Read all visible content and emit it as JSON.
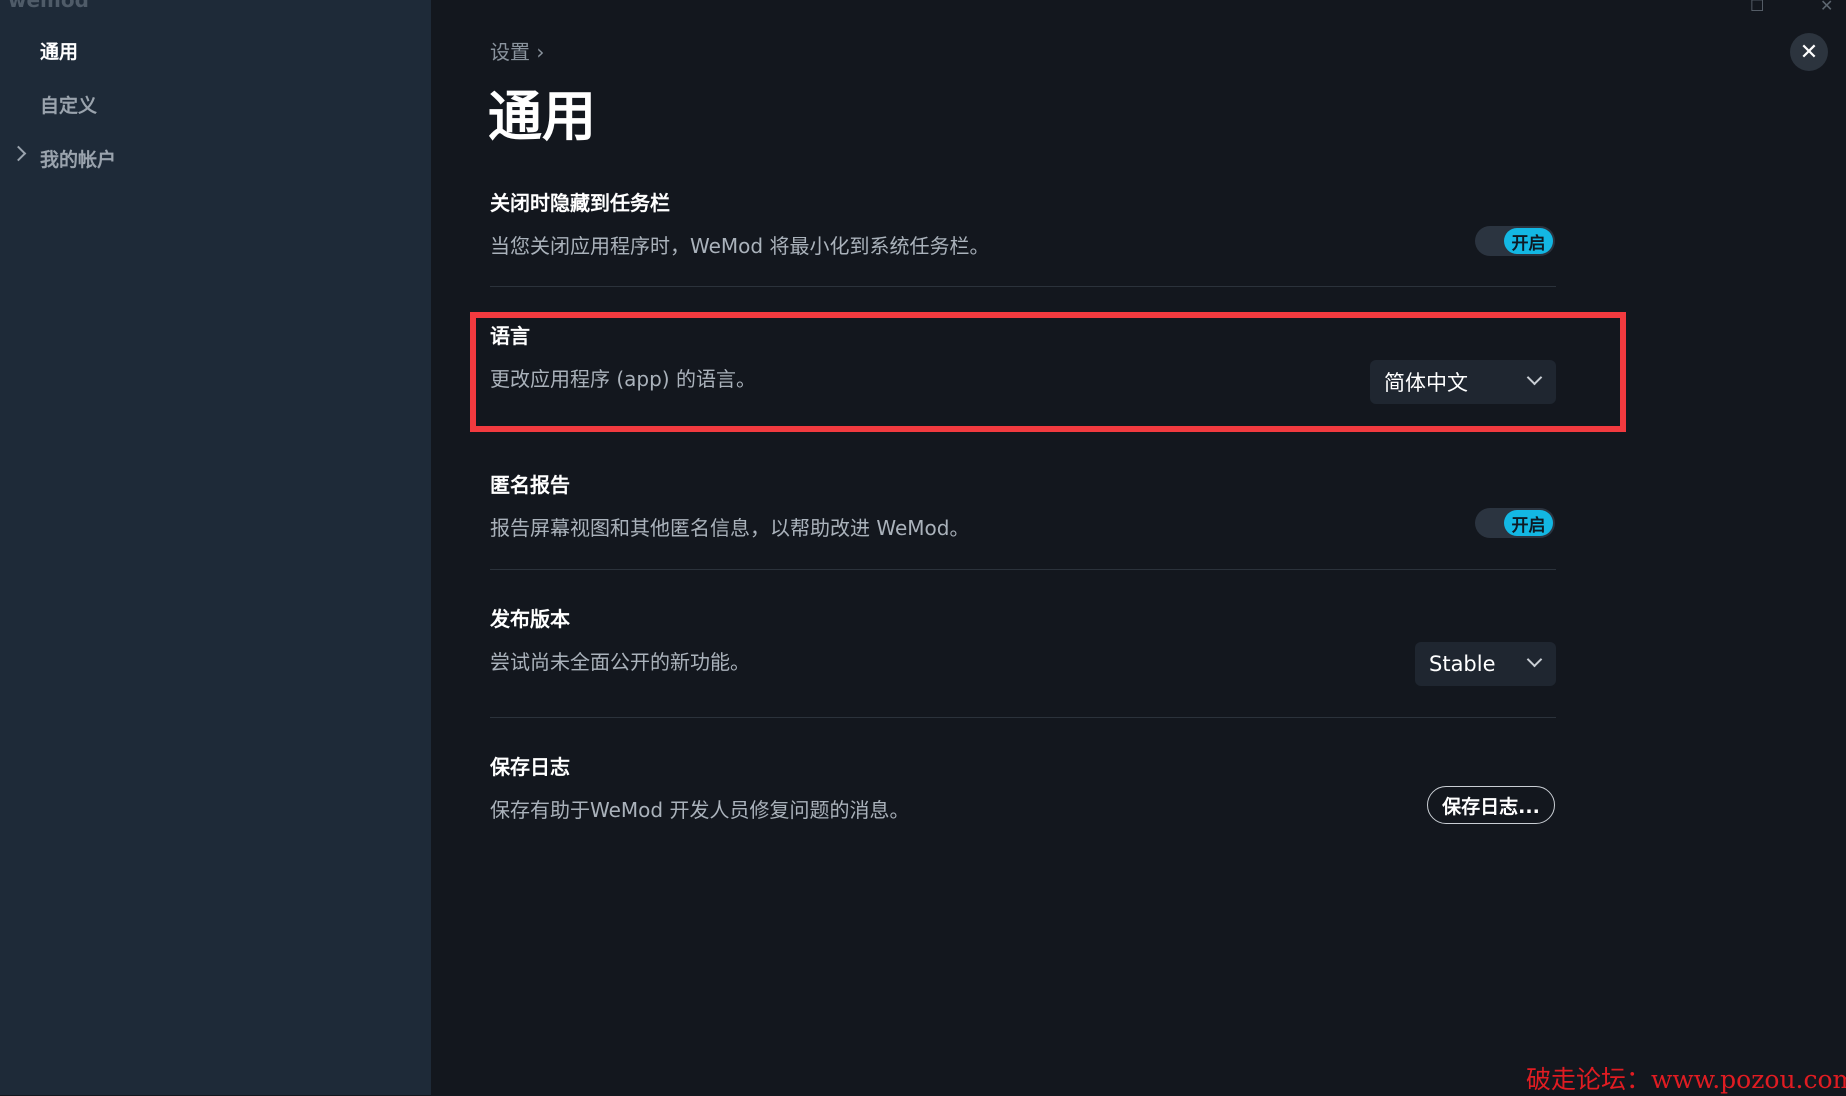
{
  "app": {
    "name": "wemod"
  },
  "sidebar": {
    "items": [
      {
        "label": "通用",
        "active": true
      },
      {
        "label": "自定义",
        "active": false
      },
      {
        "label": "我的帐户",
        "active": false,
        "expandable": true
      }
    ]
  },
  "header": {
    "breadcrumb": "设置 ›",
    "title": "通用",
    "close": "✕"
  },
  "settings": {
    "hide_on_close": {
      "title": "关闭时隐藏到任务栏",
      "desc": "当您关闭应用程序时，WeMod 将最小化到系统任务栏。",
      "toggle": "开启"
    },
    "language": {
      "title": "语言",
      "desc": "更改应用程序 (app) 的语言。",
      "value": "简体中文"
    },
    "anon_report": {
      "title": "匿名报告",
      "desc": "报告屏幕视图和其他匿名信息，以帮助改进 WeMod。",
      "toggle": "开启"
    },
    "release": {
      "title": "发布版本",
      "desc": "尝试尚未全面公开的新功能。",
      "value": "Stable"
    },
    "logs": {
      "title": "保存日志",
      "desc": "保存有助于WeMod 开发人员修复问题的消息。",
      "button": "保存日志..."
    }
  },
  "colors": {
    "accent": "#13b7e3",
    "highlight": "#f23a3f"
  },
  "watermark": "破走论坛：www.pozou.com"
}
